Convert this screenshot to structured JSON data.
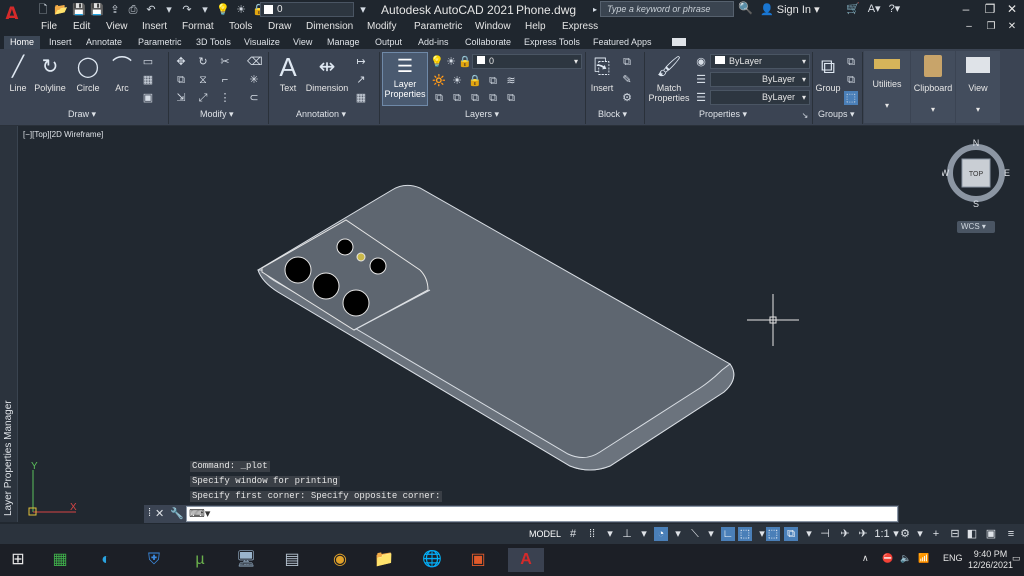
{
  "app": {
    "logo_letter": "A",
    "title": "Autodesk AutoCAD 2021",
    "file": "Phone.dwg",
    "search_placeholder": "Type a keyword or phrase",
    "signin": "Sign In",
    "qat_layer": "0"
  },
  "menu": [
    "File",
    "Edit",
    "View",
    "Insert",
    "Format",
    "Tools",
    "Draw",
    "Dimension",
    "Modify",
    "Parametric",
    "Window",
    "Help",
    "Express"
  ],
  "tabs": [
    "Home",
    "Insert",
    "Annotate",
    "Parametric",
    "3D Tools",
    "Visualize",
    "View",
    "Manage",
    "Output",
    "Add-ins",
    "Collaborate",
    "Express Tools",
    "Featured Apps"
  ],
  "ribbon": {
    "draw_tools": [
      "Line",
      "Polyline",
      "Circle",
      "Arc"
    ],
    "annotation_tools": [
      "Text",
      "Dimension"
    ],
    "layer_props": "Layer Properties",
    "layer_value": "0",
    "insert": "Insert",
    "match": "Match Properties",
    "bylayer1": "ByLayer",
    "bylayer2": "ByLayer",
    "bylayer3": "ByLayer",
    "group": "Group",
    "utilities": "Utilities",
    "clipboard": "Clipboard",
    "view": "View",
    "panels": [
      "Draw ▾",
      "Modify ▾",
      "Annotation ▾",
      "Layers ▾",
      "Block ▾",
      "Properties ▾",
      "Groups ▾"
    ]
  },
  "viewport": {
    "label": "[−][Top][2D Wireframe]",
    "side_panel": "Layer Properties Manager",
    "navcube": {
      "n": "N",
      "s": "S",
      "e": "E",
      "w": "W",
      "face": "TOP"
    },
    "wcs": "WCS"
  },
  "command": {
    "history": [
      "Command: _plot",
      "Specify window for printing",
      "Specify first corner: Specify opposite corner:"
    ],
    "input": ""
  },
  "status": {
    "model": "MODEL",
    "scale": "1:1"
  },
  "taskbar": {
    "lang": "ENG",
    "time": "9:40 PM",
    "date": "12/26/2021"
  },
  "colors": {
    "autocad_red": "#d42a2a",
    "canvas": "#212830",
    "ribbon": "#3b4453",
    "accent": "#4a7fb8"
  }
}
